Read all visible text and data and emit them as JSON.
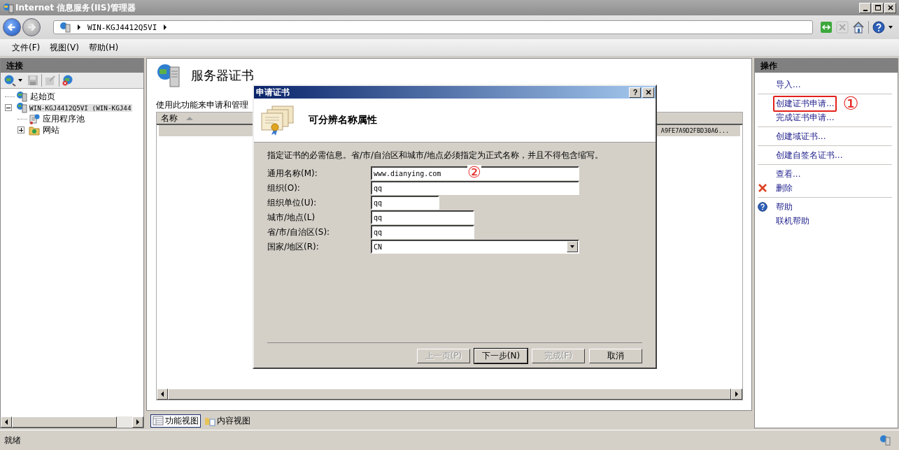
{
  "window": {
    "title": "Internet 信息服务(IIS)管理器"
  },
  "address": {
    "segments": [
      "WIN-KGJ4412Q5VI"
    ]
  },
  "menu": [
    "文件(F)",
    "视图(V)",
    "帮助(H)"
  ],
  "connections": {
    "title": "连接",
    "tree": [
      {
        "label": "起始页",
        "selected": false
      },
      {
        "label": "WIN-KGJ4412Q5VI (WIN-KGJ44",
        "selected": true,
        "expanded": true,
        "children": [
          {
            "label": "应用程序池",
            "selected": false
          },
          {
            "label": "网站",
            "selected": false,
            "expanded": false
          }
        ]
      }
    ]
  },
  "feature": {
    "title": "服务器证书",
    "description": "使用此功能来申请和管理",
    "columns": [
      {
        "label": "名称"
      }
    ],
    "rows": [
      {
        "column_2": "A9FE7A9D2FBD30A6..."
      }
    ]
  },
  "view_tabs": [
    {
      "label": "功能视图",
      "selected": true
    },
    {
      "label": "内容视图",
      "selected": false
    }
  ],
  "actions": {
    "title": "操作",
    "groups": [
      [
        {
          "label": "导入...",
          "kind": "link",
          "highlighted": false
        }
      ],
      [
        {
          "label": "创建证书申请...",
          "kind": "link",
          "highlighted": true,
          "annotation": "①"
        },
        {
          "label": "完成证书申请...",
          "kind": "link",
          "highlighted": false
        }
      ],
      [
        {
          "label": "创建域证书...",
          "kind": "link",
          "highlighted": false
        }
      ],
      [
        {
          "label": "创建自签名证书...",
          "kind": "link",
          "highlighted": false
        }
      ],
      [
        {
          "label": "查看...",
          "kind": "link",
          "highlighted": false
        },
        {
          "label": "删除",
          "kind": "delete",
          "highlighted": false
        }
      ],
      [
        {
          "label": "帮助",
          "kind": "help",
          "highlighted": false
        },
        {
          "label": "联机帮助",
          "kind": "link",
          "highlighted": false
        }
      ]
    ]
  },
  "dialog": {
    "title": "申请证书",
    "heading": "可分辨名称属性",
    "instruction": "指定证书的必需信息。省/市/自治区和城市/地点必须指定为正式名称，并且不得包含缩写。",
    "fields": [
      {
        "label": "通用名称(M):",
        "value": "www.dianying.com",
        "kind": "text",
        "annotation": "②"
      },
      {
        "label": "组织(O):",
        "value": "qq",
        "kind": "text"
      },
      {
        "label": "组织单位(U):",
        "value": "qq",
        "kind": "text"
      },
      {
        "label": "城市/地点(L)",
        "value": "qq",
        "kind": "text"
      },
      {
        "label": "省/市/自治区(S):",
        "value": "qq",
        "kind": "text"
      },
      {
        "label": "国家/地区(R):",
        "value": "CN",
        "kind": "dropdown"
      }
    ],
    "buttons": [
      {
        "label": "上一页(P)",
        "disabled": true,
        "default": false
      },
      {
        "label": "下一步(N)",
        "disabled": false,
        "default": true
      },
      {
        "label": "完成(F)",
        "disabled": true,
        "default": false
      },
      {
        "label": "取消",
        "disabled": false,
        "default": false
      }
    ]
  },
  "status_bar": {
    "text": "就绪"
  }
}
